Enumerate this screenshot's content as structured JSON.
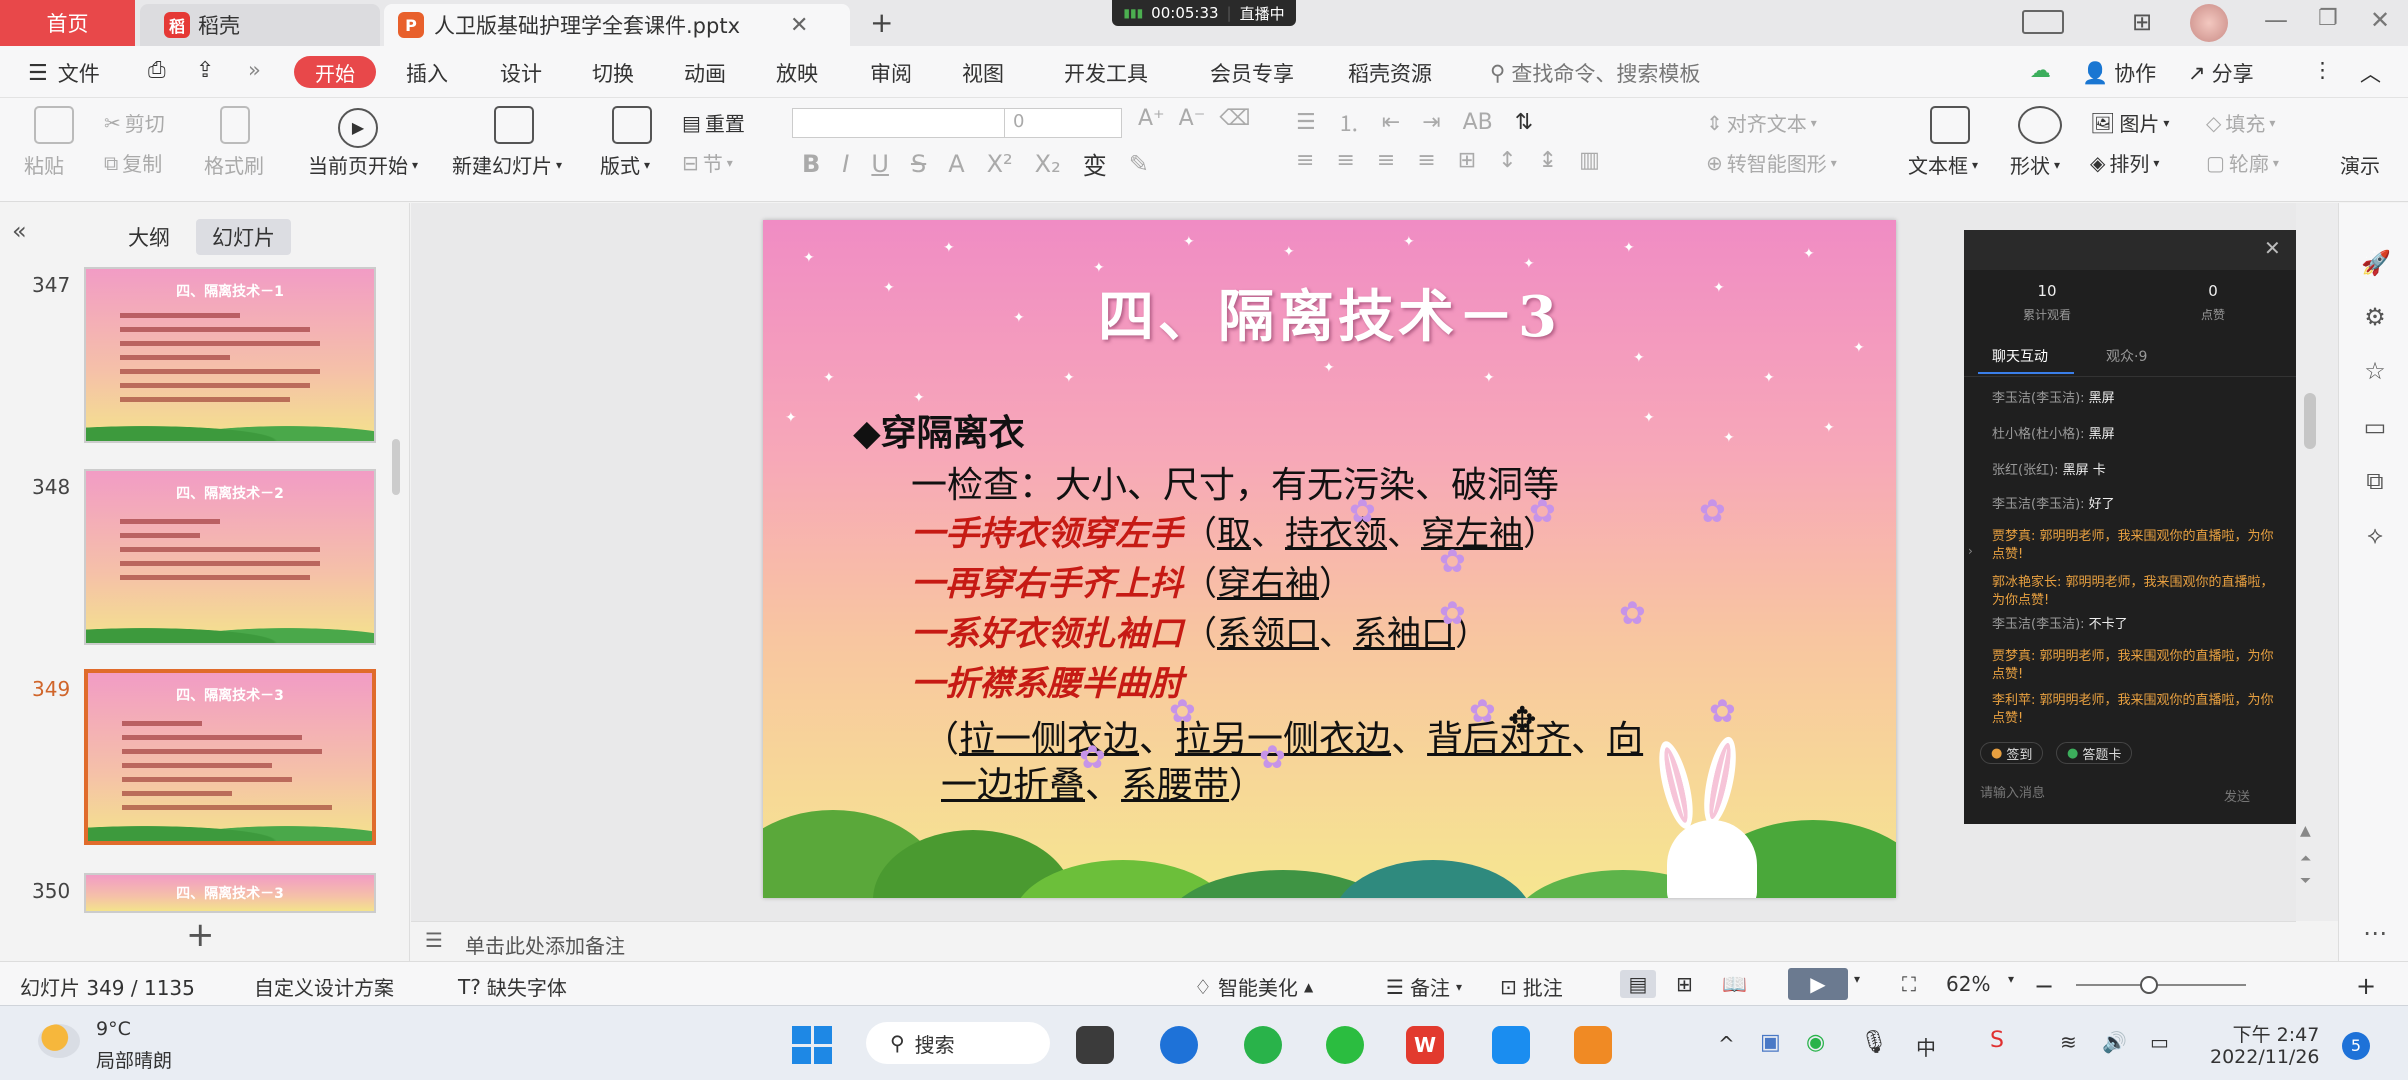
{
  "titlebar": {
    "home_tab": "首页",
    "daoke_tab": "稻壳",
    "file_tab": "人卫版基础护理学全套课件.pptx",
    "new_tab": "+",
    "timer": "00:05:33",
    "live": "直播中"
  },
  "menu": {
    "file": "文件",
    "start": "开始",
    "items": [
      "插入",
      "设计",
      "切换",
      "动画",
      "放映",
      "审阅",
      "视图",
      "开发工具",
      "会员专享",
      "稻壳资源"
    ],
    "search": "查找命令、搜索模板",
    "cooperate": "协作",
    "share": "分享"
  },
  "ribbon": {
    "paste": "粘贴",
    "cut": "剪切",
    "copy": "复制",
    "format_brush": "格式刷",
    "play_current": "当前页开始",
    "new_slide": "新建幻灯片",
    "layout": "版式",
    "reset": "重置",
    "section": "节",
    "font_size": "0",
    "align_text": "对齐文本",
    "smart_graphic": "转智能图形",
    "textbox": "文本框",
    "shape": "形状",
    "picture": "图片",
    "fill": "填充",
    "arrange": "排列",
    "outline": "轮廓",
    "present": "演示"
  },
  "leftpanel": {
    "tab_outline": "大纲",
    "tab_slides": "幻灯片",
    "thumbs": [
      {
        "num": "347",
        "title": "四、隔离技术－1"
      },
      {
        "num": "348",
        "title": "四、隔离技术－2"
      },
      {
        "num": "349",
        "title": "四、隔离技术－3"
      },
      {
        "num": "350",
        "title": "四、隔离技术－3"
      }
    ],
    "add": "+"
  },
  "slide": {
    "title": "四、隔离技术－3",
    "heading": "◆穿隔离衣",
    "line1": "一检查：大小、尺寸，有无污染、破洞等",
    "line2_red": "一手持衣领穿左手",
    "line2_a": "（",
    "line2_u1": "取",
    "line2_sep1": "、",
    "line2_u2": "持衣领",
    "line2_sep2": "、",
    "line2_u3": "穿左袖",
    "line2_b": "）",
    "line3_red": "一再穿右手齐上抖",
    "line3_a": "（",
    "line3_u1": "穿右袖",
    "line3_b": "）",
    "line4_red": "一系好衣领扎袖口",
    "line4_a": "（",
    "line4_u1": "系领口",
    "line4_sep": "、",
    "line4_u2": "系袖口",
    "line4_b": "）",
    "line5_red": "一折襟系腰半曲肘",
    "line6_a": "（",
    "line6_u1": "拉一侧衣边",
    "line6_sep1": "、",
    "line6_u2": "拉另一侧衣边",
    "line6_sep2": "、",
    "line6_u3": "背后对齐",
    "line6_sep3": "、",
    "line6_u4a": "向",
    "line7_u4b": "一边折叠",
    "line7_sep": "、",
    "line7_u5": "系腰带",
    "line7_b": "）"
  },
  "notes": {
    "placeholder": "单击此处添加备注"
  },
  "status": {
    "slide_count": "幻灯片 349 / 1135",
    "design": "自定义设计方案",
    "missing_font": "缺失字体",
    "beautify": "智能美化",
    "notes": "备注",
    "comment": "批注",
    "zoom": "62%"
  },
  "chat": {
    "viewers": "10",
    "viewers_label": "累计观看",
    "likes": "0",
    "likes_label": "点赞",
    "tab_chat": "聊天互动",
    "tab_audience": "观众·9",
    "messages": [
      {
        "user": "李玉洁(李玉洁):",
        "text": "黑屏",
        "gold": false
      },
      {
        "user": "杜小格(杜小格):",
        "text": "黑屏",
        "gold": false
      },
      {
        "user": "张红(张红):",
        "text": "黑屏 卡",
        "gold": false
      },
      {
        "user": "李玉洁(李玉洁):",
        "text": "好了",
        "gold": false
      },
      {
        "user": "贾梦真:",
        "text": "郭明明老师，我来围观你的直播啦，为你点赞!",
        "gold": true
      },
      {
        "user": "郭冰艳家长:",
        "text": "郭明明老师，我来围观你的直播啦，为你点赞!",
        "gold": true
      },
      {
        "user": "李玉洁(李玉洁):",
        "text": "不卡了",
        "gold": false
      },
      {
        "user": "贾梦真:",
        "text": "郭明明老师，我来围观你的直播啦，为你点赞!",
        "gold": true
      },
      {
        "user": "李利苹:",
        "text": "郭明明老师，我来围观你的直播啦，为你点赞!",
        "gold": true
      }
    ],
    "signin": "签到",
    "answer": "答题卡",
    "input_placeholder": "请输入消息",
    "send": "发送"
  },
  "taskbar": {
    "temp": "9°C",
    "weather": "局部晴朗",
    "search": "搜索",
    "time": "下午 2:47",
    "date": "2022/11/26",
    "badge": "5",
    "ime": "中"
  },
  "colors": {
    "accent": "#e8484a",
    "chat_gold": "#e8a040",
    "slide_red": "#c61a14"
  }
}
